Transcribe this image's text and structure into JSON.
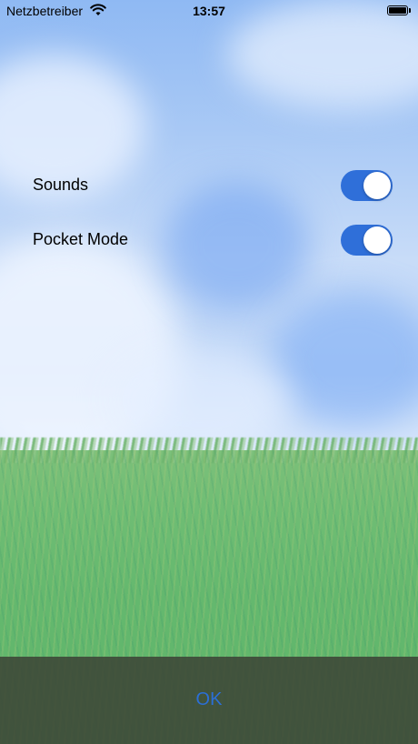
{
  "status_bar": {
    "carrier": "Netzbetreiber",
    "time": "13:57",
    "wifi_icon": "wifi-icon",
    "battery_icon": "battery-icon"
  },
  "settings": {
    "sounds": {
      "label": "Sounds",
      "enabled": true
    },
    "pocket_mode": {
      "label": "Pocket Mode",
      "enabled": true
    }
  },
  "footer": {
    "ok_label": "OK"
  },
  "colors": {
    "accent": "#2b6fd6",
    "toggle_on": "#2f6fd9"
  }
}
